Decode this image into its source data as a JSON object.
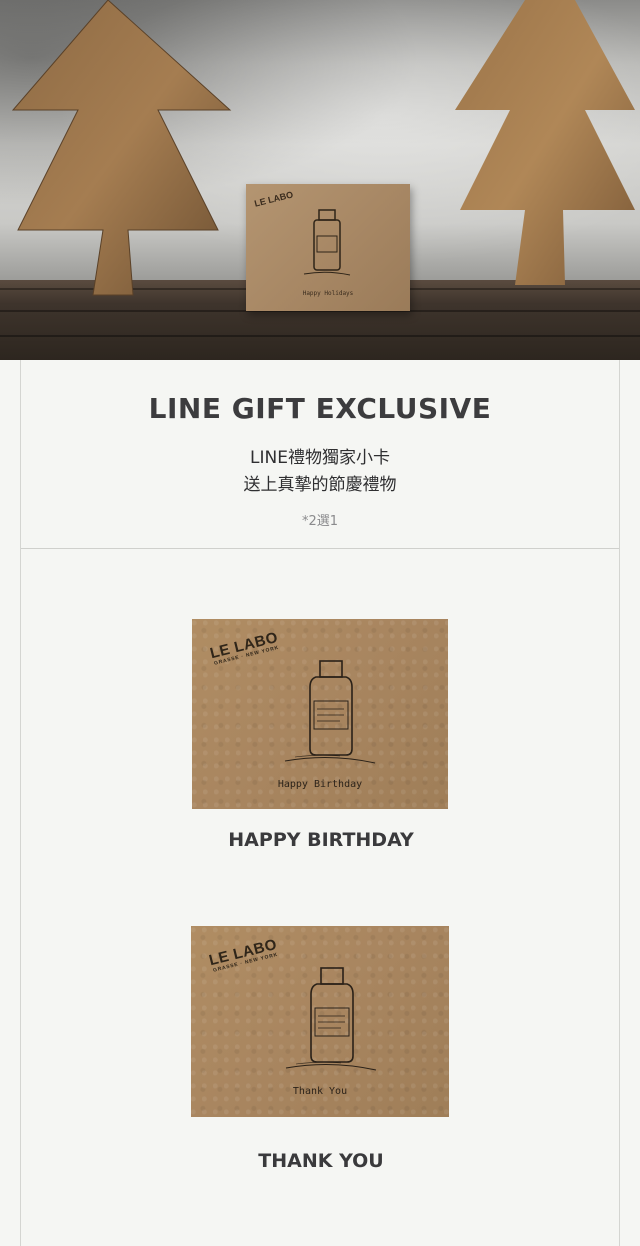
{
  "hero": {
    "card_logo": "LE LABO",
    "card_greeting": "Happy Holidays"
  },
  "intro": {
    "headline": "LINE GIFT EXCLUSIVE",
    "subtitle_line1": "LINE禮物獨家小卡",
    "subtitle_line2": "送上真摯的節慶禮物",
    "note": "*2選1"
  },
  "options": [
    {
      "card_logo": "LE LABO",
      "card_logo_sub": "GRASSE · NEW YORK",
      "card_greeting": "Happy Birthday",
      "label": "HAPPY BIRTHDAY"
    },
    {
      "card_logo": "LE LABO",
      "card_logo_sub": "GRASSE · NEW YORK",
      "card_greeting": "Thank You",
      "label": "THANK YOU"
    }
  ]
}
